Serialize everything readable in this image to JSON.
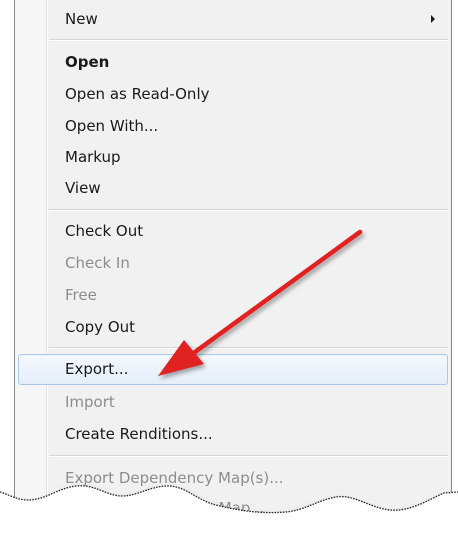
{
  "menu": {
    "items": [
      {
        "label": "New"
      },
      {
        "label": "Open"
      },
      {
        "label": "Open as Read-Only"
      },
      {
        "label": "Open With..."
      },
      {
        "label": "Markup"
      },
      {
        "label": "View"
      },
      {
        "label": "Check Out"
      },
      {
        "label": "Check In"
      },
      {
        "label": "Free"
      },
      {
        "label": "Copy Out"
      },
      {
        "label": "Export..."
      },
      {
        "label": "Import"
      },
      {
        "label": "Create Renditions..."
      },
      {
        "label": "Export Dependency Map(s)..."
      },
      {
        "label": "Import Dependency Map..."
      }
    ]
  },
  "colors": {
    "menu_background": "#f1f1f1",
    "highlight_border": "#a8c8ec",
    "disabled_text": "#8d8d8d",
    "annotation_arrow": "#e02020"
  },
  "icons": {
    "submenu_indicator": "chevron-right-icon",
    "annotation": "red-arrow-annotation"
  }
}
